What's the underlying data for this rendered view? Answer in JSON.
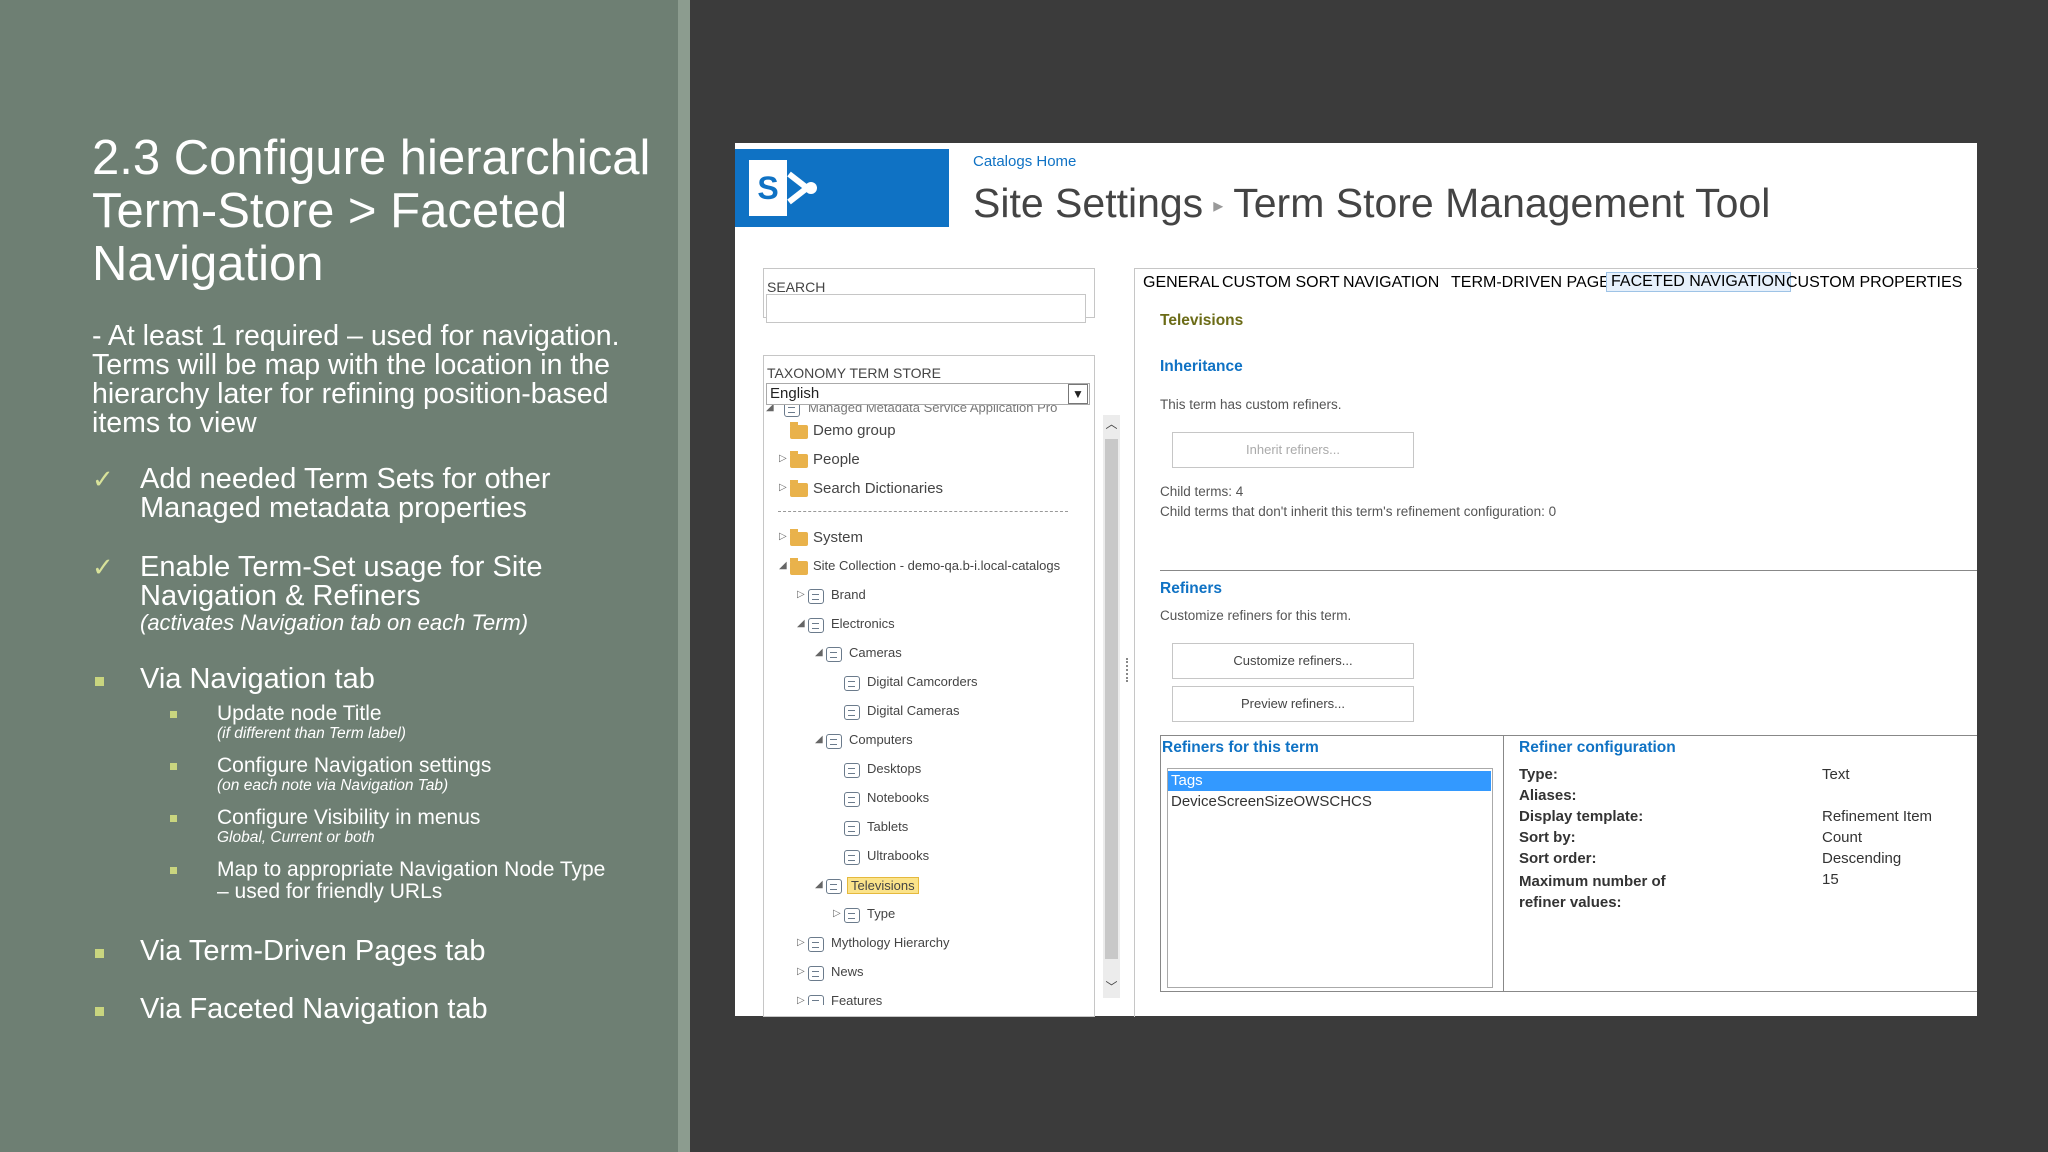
{
  "slide": {
    "title": "2.3 Configure hierarchical Term-Store > Faceted Navigation",
    "intro": " - At least 1 required – used for navigation. Terms will be map with the location in the hierarchy later for refining position-based items to view",
    "bullets": [
      {
        "text": "Add needed Term Sets for other Managed metadata properties",
        "note": ""
      },
      {
        "text": "Enable Term-Set usage for Site Navigation & Refiners",
        "note": "(activates Navigation tab on each Term)"
      },
      {
        "text": "Via Navigation tab",
        "note": ""
      },
      {
        "text": "Via Term-Driven Pages tab",
        "note": ""
      },
      {
        "text": "Via Faceted Navigation tab",
        "note": ""
      }
    ],
    "subbullets": [
      {
        "text": "Update node Title",
        "note": "(if different than Term label)"
      },
      {
        "text": "Configure Navigation settings",
        "note": "(on each note via Navigation Tab)"
      },
      {
        "text": "Configure Visibility in menus",
        "note": "Global, Current or both"
      },
      {
        "text": "Map to appropriate Navigation Node Type – used for friendly URLs",
        "note": ""
      }
    ],
    "colors": {
      "left_bg": "#6e7f73",
      "accent": "#c9d57f",
      "right_bg": "#3b3b3b"
    }
  },
  "sharepoint": {
    "breadcrumb": "Catalogs Home",
    "title_part1": "Site Settings",
    "title_sep": "▸",
    "title_part2": "Term Store Management Tool",
    "search_label": "SEARCH",
    "taxonomy_label": "TAXONOMY TERM STORE",
    "language": "English",
    "tree": [
      "Managed Metadata Service Application Pro",
      "Demo group",
      "People",
      "Search Dictionaries",
      "System",
      "Site Collection - demo-qa.b-i.local-catalogs",
      "Brand",
      "Electronics",
      "Cameras",
      "Digital Camcorders",
      "Digital Cameras",
      "Computers",
      "Desktops",
      "Notebooks",
      "Tablets",
      "Ultrabooks",
      "Televisions",
      "Type",
      "Mythology Hierarchy",
      "News",
      "Features"
    ],
    "tabs": [
      "GENERAL",
      "CUSTOM SORT",
      "NAVIGATION",
      "TERM-DRIVEN PAGES",
      "FACETED NAVIGATION",
      "CUSTOM PROPERTIES"
    ],
    "active_tab": "FACETED NAVIGATION",
    "term_name": "Televisions",
    "inheritance_header": "Inheritance",
    "inheritance_text": "This term has custom refiners.",
    "inherit_button": "Inherit refiners...",
    "child_terms": "Child terms: 4",
    "child_terms_note": "Child terms that don't inherit this term's refinement configuration: 0",
    "refiners_header": "Refiners",
    "refiners_text": "Customize refiners for this term.",
    "customize_button": "Customize refiners...",
    "preview_button": "Preview refiners...",
    "refiners_list_header": "Refiners for this term",
    "refiners_list": [
      "Tags",
      "DeviceScreenSizeOWSCHCS"
    ],
    "refiner_config_header": "Refiner configuration",
    "config": [
      {
        "label": "Type:",
        "value": "Text"
      },
      {
        "label": "Aliases:",
        "value": ""
      },
      {
        "label": "Display template:",
        "value": "Refinement Item"
      },
      {
        "label": "Sort by:",
        "value": "Count"
      },
      {
        "label": "Sort order:",
        "value": "Descending"
      },
      {
        "label": "Maximum number of refiner values:",
        "value": "15"
      }
    ],
    "colors": {
      "brand": "#0f72c4",
      "selection": "#3399ff",
      "highlight": "#fbe38a"
    }
  }
}
